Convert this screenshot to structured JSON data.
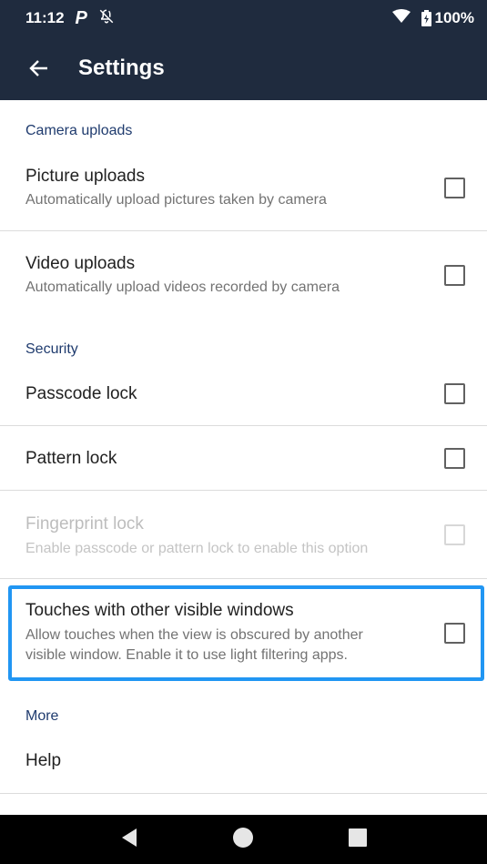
{
  "status_bar": {
    "time": "11:12",
    "battery": "100%"
  },
  "app_bar": {
    "title": "Settings"
  },
  "sections": {
    "camera_uploads": "Camera uploads",
    "security": "Security",
    "more": "More"
  },
  "rows": {
    "picture_uploads": {
      "title": "Picture uploads",
      "subtitle": "Automatically upload pictures taken by camera"
    },
    "video_uploads": {
      "title": "Video uploads",
      "subtitle": "Automatically upload videos recorded by camera"
    },
    "passcode_lock": {
      "title": "Passcode lock"
    },
    "pattern_lock": {
      "title": "Pattern lock"
    },
    "fingerprint_lock": {
      "title": "Fingerprint lock",
      "subtitle": "Enable passcode or pattern lock to enable this option"
    },
    "touches": {
      "title": "Touches with other visible windows",
      "subtitle_line1": "Allow touches when the view is obscured by another",
      "subtitle_line2": "visible window. Enable it to use light filtering apps."
    },
    "help": {
      "title": "Help"
    }
  },
  "colors": {
    "app_bar": "#1f2b3e",
    "section_header": "#1f3b6e",
    "highlight": "#2196f3"
  }
}
